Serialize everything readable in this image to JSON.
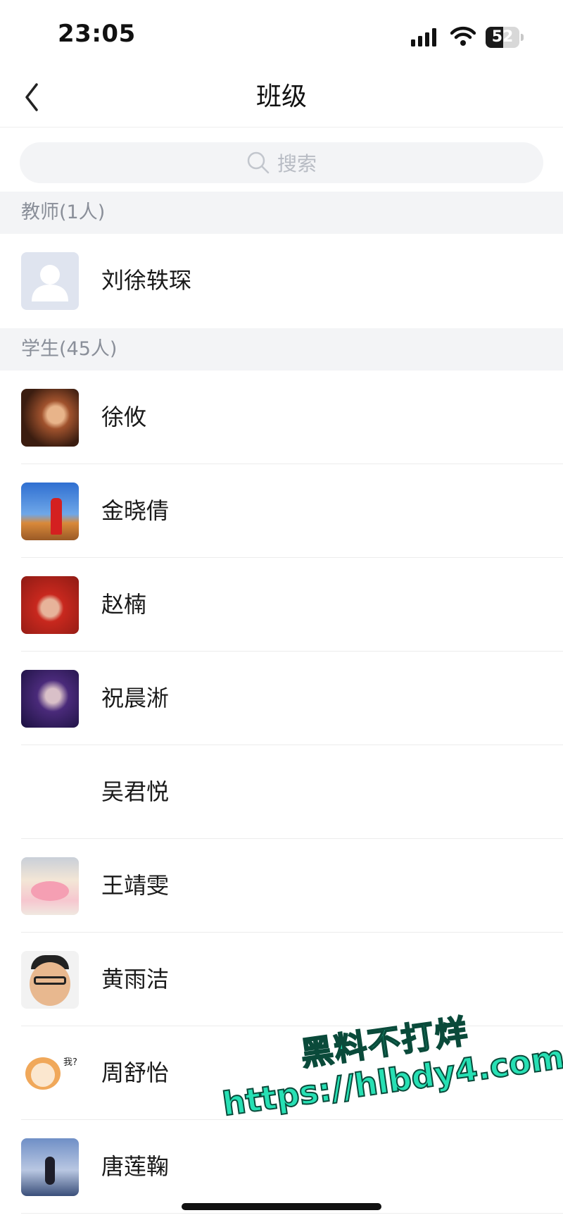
{
  "status_bar": {
    "time": "23:05",
    "battery": "52",
    "battery_level": 0.52
  },
  "nav": {
    "title": "班级"
  },
  "search": {
    "placeholder": "搜索"
  },
  "sections": {
    "teachers": {
      "header": "教师(1人)",
      "items": [
        {
          "name": "刘徐轶琛",
          "avatar": "default-user"
        }
      ]
    },
    "students": {
      "header": "学生(45人)",
      "items": [
        {
          "name": "徐攸",
          "avatar": "photo"
        },
        {
          "name": "金晓倩",
          "avatar": "photo"
        },
        {
          "name": "赵楠",
          "avatar": "photo"
        },
        {
          "name": "祝晨淅",
          "avatar": "photo"
        },
        {
          "name": "吴君悦",
          "avatar": "none"
        },
        {
          "name": "王靖雯",
          "avatar": "illustration"
        },
        {
          "name": "黄雨洁",
          "avatar": "photo"
        },
        {
          "name": "周舒怡",
          "avatar": "cat-sticker"
        },
        {
          "name": "唐莲鞠",
          "avatar": "photo"
        }
      ]
    }
  },
  "watermark": {
    "line1": "黑料不打烊",
    "line2": "https://hlbdy4.com"
  },
  "colors": {
    "accent_watermark": "#27e0b4",
    "section_bg": "#f3f4f6",
    "placeholder_gray": "#b8bcc4"
  }
}
